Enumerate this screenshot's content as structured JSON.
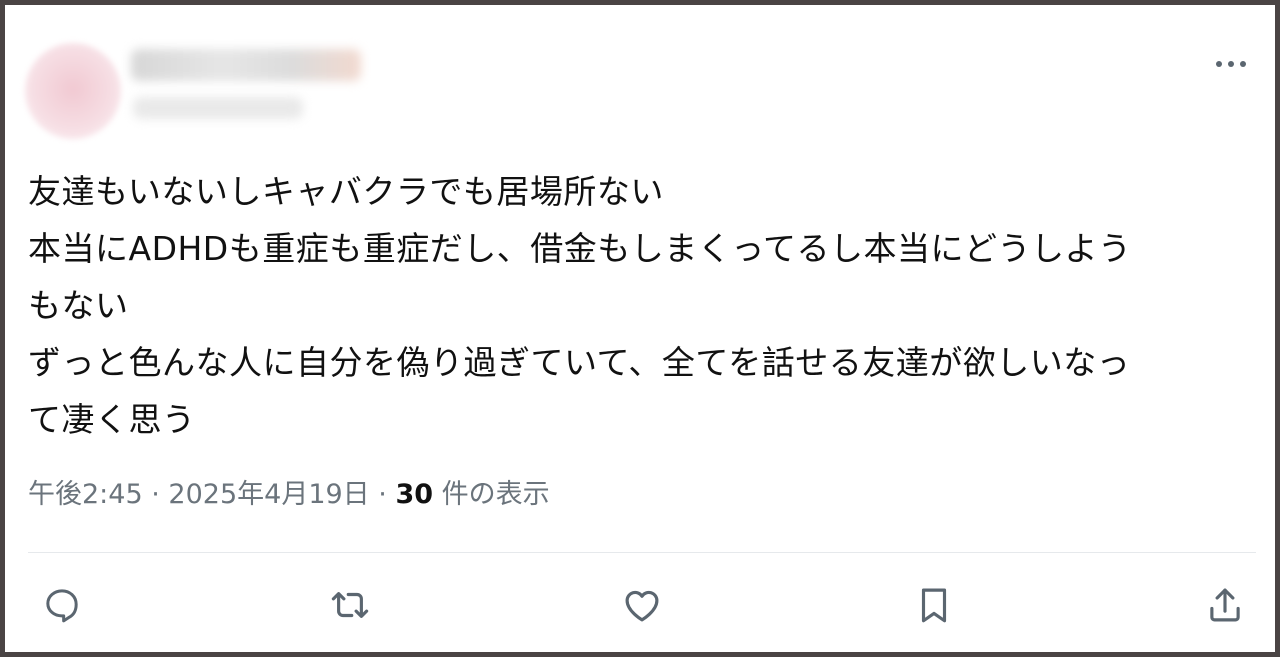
{
  "tweet": {
    "text_lines": [
      "友達もいないしキャバクラでも居場所ない",
      "本当にADHDも重症も重症だし、借金もしまくってるし本当にどうしよう",
      "もない",
      "ずっと色んな人に自分を偽り過ぎていて、全てを話せる友達が欲しいなっ",
      "て凄く思う"
    ],
    "time": "午後2:45",
    "separator": "·",
    "date": "2025年4月19日",
    "views_count": "30",
    "views_label": "件の表示"
  },
  "icons": {
    "more": "more-horizontal-icon",
    "reply": "reply-icon",
    "retweet": "retweet-icon",
    "like": "heart-icon",
    "bookmark": "bookmark-icon",
    "share": "share-icon"
  },
  "colors": {
    "text": "#111111",
    "secondary_text": "#6b747c",
    "icon": "#5b6670",
    "frame": "#4a4444",
    "divider": "#e6e9ec"
  }
}
